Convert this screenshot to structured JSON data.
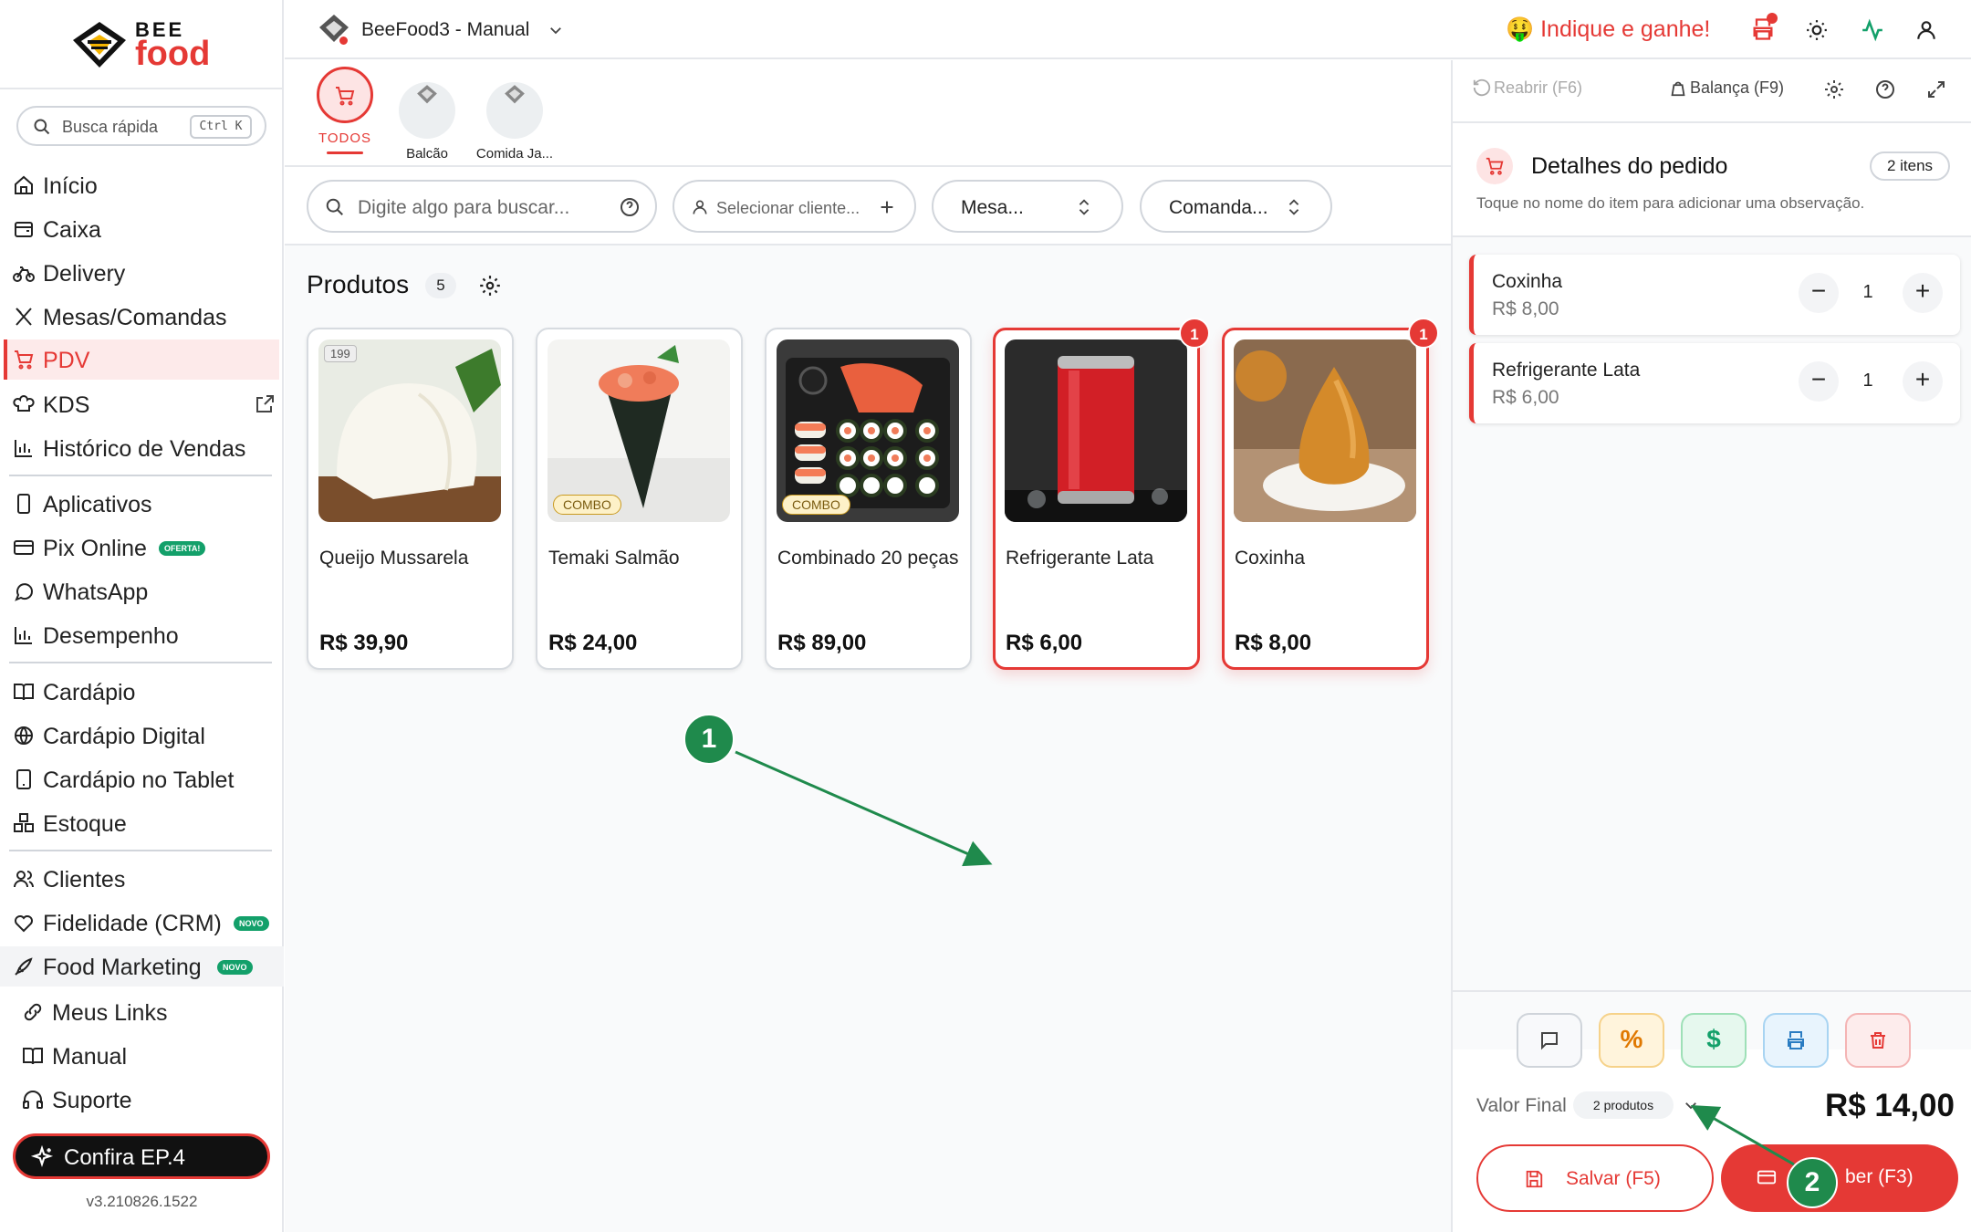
{
  "sidebar": {
    "logo_top": "BEE",
    "logo_bottom": "food",
    "search_placeholder": "Busca rápida",
    "search_shortcut": "Ctrl K",
    "items": [
      {
        "label": "Início",
        "icon": "home-icon"
      },
      {
        "label": "Caixa",
        "icon": "cash-register-icon"
      },
      {
        "label": "Delivery",
        "icon": "bicycle-icon"
      },
      {
        "label": "Mesas/Comandas",
        "icon": "utensils-icon"
      },
      {
        "label": "PDV",
        "icon": "cart-icon",
        "active": true
      },
      {
        "label": "KDS",
        "icon": "chef-hat-icon"
      },
      {
        "label": "Histórico de Vendas",
        "icon": "bar-chart-icon"
      },
      {
        "label": "Aplicativos",
        "icon": "smartphone-icon"
      },
      {
        "label": "Pix Online",
        "icon": "card-icon",
        "badge": "OFERTA!"
      },
      {
        "label": "WhatsApp",
        "icon": "chat-bubble-icon"
      },
      {
        "label": "Desempenho",
        "icon": "bar-chart-icon"
      },
      {
        "label": "Cardápio",
        "icon": "book-open-icon"
      },
      {
        "label": "Cardápio Digital",
        "icon": "globe-icon"
      },
      {
        "label": "Cardápio no Tablet",
        "icon": "tablet-icon"
      },
      {
        "label": "Estoque",
        "icon": "boxes-icon"
      },
      {
        "label": "Clientes",
        "icon": "users-icon"
      },
      {
        "label": "Fidelidade (CRM)",
        "icon": "heart-icon",
        "badge": "NOVO"
      },
      {
        "label": "Food Marketing",
        "icon": "rocket-icon",
        "badge": "NOVO"
      },
      {
        "label": "Meus Links",
        "icon": "link-icon"
      },
      {
        "label": "Manual",
        "icon": "book-icon"
      },
      {
        "label": "Suporte",
        "icon": "headset-icon"
      }
    ],
    "promo_label": "Confira EP.4",
    "version": "v3.210826.1522"
  },
  "header": {
    "app_name": "BeeFood3 - Manual",
    "referral_label": "Indique e ganhe!",
    "referral_emoji": "🤑"
  },
  "categories": [
    {
      "label": "TODOS",
      "active": true
    },
    {
      "label": "Balcão"
    },
    {
      "label": "Comida Ja..."
    }
  ],
  "filters": {
    "search_placeholder": "Digite algo para buscar...",
    "client_placeholder": "Selecionar cliente...",
    "table_placeholder": "Mesa...",
    "comanda_placeholder": "Comanda..."
  },
  "products_section": {
    "title": "Produtos",
    "count": "5"
  },
  "products": [
    {
      "name": "Queijo Mussarela",
      "price": "R$ 39,90",
      "code": "199"
    },
    {
      "name": "Temaki Salmão",
      "price": "R$ 24,00",
      "tag": "COMBO"
    },
    {
      "name": "Combinado 20 peças",
      "price": "R$ 89,00",
      "tag": "COMBO"
    },
    {
      "name": "Refrigerante Lata",
      "price": "R$ 6,00",
      "in_cart": "1"
    },
    {
      "name": "Coxinha",
      "price": "R$ 8,00",
      "in_cart": "1"
    }
  ],
  "order_panel": {
    "toolbar": {
      "reopen": "Reabrir (F6)",
      "scale": "Balança (F9)"
    },
    "title": "Detalhes do pedido",
    "item_count": "2 itens",
    "hint": "Toque no nome do item para adicionar uma observação.",
    "items": [
      {
        "name": "Coxinha",
        "price": "R$ 8,00",
        "qty": "1"
      },
      {
        "name": "Refrigerante Lata",
        "price": "R$ 6,00",
        "qty": "1"
      }
    ],
    "total_label": "Valor Final",
    "total_products": "2 produtos",
    "total_value": "R$ 14,00",
    "save_label": "Salvar (F5)",
    "receive_label": "ber (F3)"
  },
  "annotations": [
    "1",
    "2"
  ],
  "colors": {
    "accent": "#e53935",
    "badge_green": "#13a06a",
    "annotation_green": "#1f8a4c"
  }
}
